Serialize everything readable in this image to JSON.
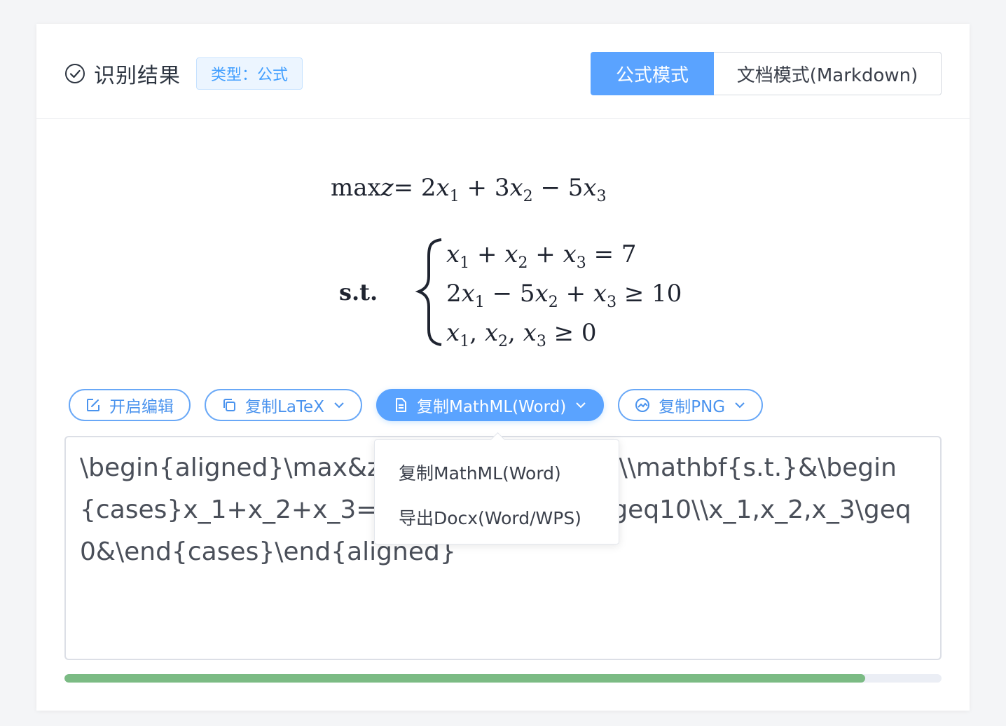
{
  "header": {
    "title": "识别结果",
    "type_badge": "类型：公式",
    "modes": [
      {
        "label": "公式模式",
        "active": true
      },
      {
        "label": "文档模式(Markdown)",
        "active": false
      }
    ]
  },
  "formula": {
    "line1": {
      "lhs": "max",
      "var": "z",
      "rhs_parts": [
        "= 2",
        "x",
        "1",
        " + 3",
        "x",
        "2",
        " − 5",
        "x",
        "3"
      ]
    },
    "st_label": "s.t.",
    "case1": [
      "x",
      "1",
      " + ",
      "x",
      "2",
      " + ",
      "x",
      "3",
      " = 7"
    ],
    "case2": [
      "2",
      "x",
      "1",
      " − 5",
      "x",
      "2",
      " + ",
      "x",
      "3",
      " ≥ 10"
    ],
    "case3": [
      "x",
      "1",
      ", ",
      "x",
      "2",
      ", ",
      "x",
      "3",
      " ≥ 0"
    ]
  },
  "actions": {
    "edit": "开启编辑",
    "copy_latex": "复制LaTeX",
    "copy_mathml": "复制MathML(Word)",
    "copy_png": "复制PNG"
  },
  "textarea": {
    "value": "\\begin{aligned}\\max&z=2x_1+3x_2-5x_3\\\\\\mathbf{s.t.}&\\begin{cases}x_1+x_2+x_3=7\\\\2x_1-5x_2+x_3\\geq10\\\\x_1,x_2,x_3\\geq0&\\end{cases}\\end{aligned}"
  },
  "progress": {
    "value": 0.913
  },
  "dropdown": {
    "items": [
      "复制MathML(Word)",
      "导出Docx(Word/WPS)"
    ]
  },
  "colors": {
    "primary": "#409eff",
    "button_fill": "#5aa3ff",
    "progress": "#7bbb84"
  }
}
